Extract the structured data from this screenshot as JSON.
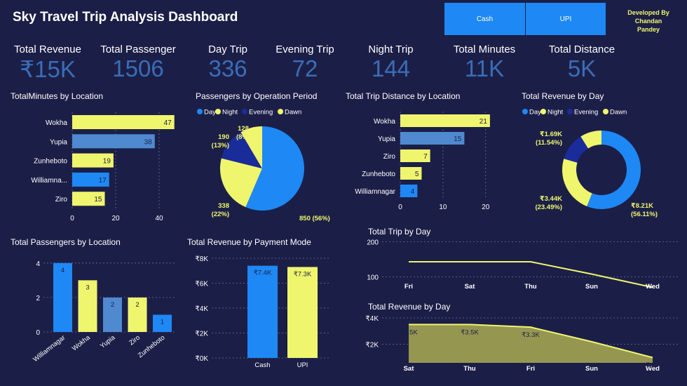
{
  "header": {
    "title": "Sky Travel Trip Analysis Dashboard",
    "slicers": [
      "Cash",
      "UPI"
    ],
    "developer_line1": "Developed By",
    "developer_line2": "Chandan",
    "developer_line3": "Pandey"
  },
  "kpis": [
    {
      "label": "Total Revenue",
      "value": "₹15K"
    },
    {
      "label": "Total Passenger",
      "value": "1506"
    },
    {
      "label": "Day Trip",
      "value": "336"
    },
    {
      "label": "Evening Trip",
      "value": "72"
    },
    {
      "label": "Night Trip",
      "value": "144"
    },
    {
      "label": "Total Minutes",
      "value": "11K"
    },
    {
      "label": "Total Distance",
      "value": "5K"
    }
  ],
  "colors": {
    "background": "#1b1f47",
    "blue": "#1e88f5",
    "yellow": "#f0f56e",
    "steel_blue": "#4f8ad0",
    "navy": "#1a2b9a",
    "kpi_value": "#3b6db8",
    "area_fill": "#9c9e52"
  },
  "chart_data": [
    {
      "id": "minutes_by_location",
      "type": "bar",
      "orientation": "horizontal",
      "title": "TotalMinutes by Location",
      "categories": [
        "Wokha",
        "Yupia",
        "Zunheboto",
        "Williamna...",
        "Ziro"
      ],
      "values": [
        47,
        38,
        19,
        17,
        15
      ],
      "xlim": [
        0,
        50
      ],
      "ticks": [
        0,
        20,
        40
      ]
    },
    {
      "id": "passengers_by_period",
      "type": "pie",
      "title": "Passengers by Operation Period",
      "legend": [
        "Day",
        "Night",
        "Evening",
        "Dawn"
      ],
      "slices": [
        {
          "name": "Day",
          "value": 850,
          "label_line1": "850 (56%)",
          "label_line2": ""
        },
        {
          "name": "Night",
          "value": 338,
          "label_line1": "338",
          "label_line2": "(22%)"
        },
        {
          "name": "Evening",
          "value": 190,
          "label_line1": "190",
          "label_line2": "(13%)"
        },
        {
          "name": "Dawn",
          "value": 128,
          "label_line1": "128",
          "label_line2": "(8%)"
        }
      ]
    },
    {
      "id": "distance_by_location",
      "type": "bar",
      "orientation": "horizontal",
      "title": "Total Trip Distance by Location",
      "categories": [
        "Wokha",
        "Yupia",
        "Ziro",
        "Zunheboto",
        "Williamnagar"
      ],
      "values": [
        21,
        15,
        7,
        5,
        4
      ],
      "xlim": [
        0,
        22
      ],
      "ticks": [
        0,
        10,
        20
      ]
    },
    {
      "id": "revenue_by_day_donut",
      "type": "pie",
      "title": "Total Revenue by Day",
      "legend": [
        "Day",
        "Night",
        "Evening",
        "Dawn"
      ],
      "slices": [
        {
          "name": "Day",
          "value": 8.21,
          "label_line1": "₹8.21K",
          "label_line2": "(56.11%)"
        },
        {
          "name": "Night",
          "value": 3.44,
          "label_line1": "₹3.44K",
          "label_line2": "(23.49%)"
        },
        {
          "name": "Evening",
          "value": 1.69,
          "label_line1": "₹1.69K",
          "label_line2": "(11.54%)"
        },
        {
          "name": "Dawn",
          "value": 1.3,
          "label_line1": "",
          "label_line2": ""
        }
      ]
    },
    {
      "id": "passengers_by_location",
      "type": "bar",
      "title": "Total Passengers by Location",
      "categories": [
        "Williamnagar",
        "Wokha",
        "Yupia",
        "Ziro",
        "Zunheboto"
      ],
      "values": [
        4,
        3,
        2,
        2,
        1
      ],
      "ylim": [
        0,
        4.4
      ],
      "ticks": [
        0,
        2,
        4
      ]
    },
    {
      "id": "revenue_by_payment",
      "type": "bar",
      "title": "Total Revenue by Payment Mode",
      "categories": [
        "Cash",
        "UPI"
      ],
      "values": [
        7.4,
        7.3
      ],
      "value_labels": [
        "₹7.4K",
        "₹7.3K"
      ],
      "ylim": [
        0,
        8
      ],
      "tick_values": [
        0,
        2,
        4,
        6,
        8
      ],
      "tick_labels": [
        "₹0K",
        "₹2K",
        "₹4K",
        "₹6K",
        "₹8K"
      ]
    },
    {
      "id": "trip_by_day",
      "type": "line",
      "title": "Total Trip by Day",
      "categories": [
        "Fri",
        "Sat",
        "Thu",
        "Sun",
        "Wed"
      ],
      "values": [
        143,
        143,
        143,
        108,
        70
      ],
      "ylim": [
        55,
        215
      ],
      "ticks": [
        100,
        200
      ]
    },
    {
      "id": "revenue_by_day_area",
      "type": "area",
      "title": "Total Revenue by Day",
      "categories": [
        "Sat",
        "Thu",
        "Fri",
        "Sun",
        "Wed"
      ],
      "values": [
        3.5,
        3.5,
        3.3,
        2.2,
        1.0
      ],
      "value_labels": [
        "₹3.5K",
        "₹3.5K",
        "₹3.3K",
        "",
        "₹1"
      ],
      "ylim": [
        0.6,
        4
      ],
      "tick_values": [
        2,
        4
      ],
      "tick_labels": [
        "₹2K",
        "₹4K"
      ]
    }
  ]
}
